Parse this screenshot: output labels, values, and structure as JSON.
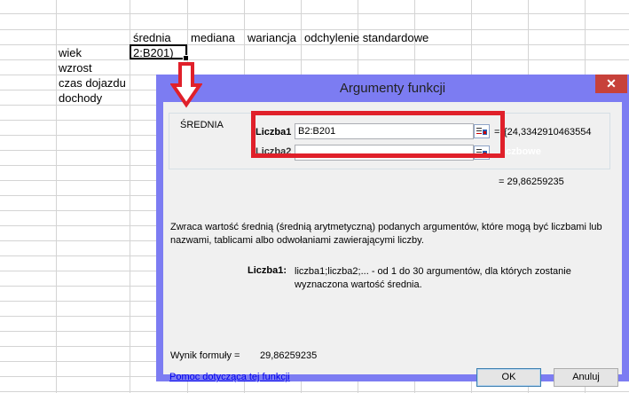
{
  "sheet": {
    "headers": [
      "średnia",
      "mediana",
      "wariancja",
      "odchylenie standardowe"
    ],
    "rows": [
      "wiek",
      "wzrost",
      "czas dojazdu",
      "dochody"
    ],
    "active_cell_value": "2:B201)"
  },
  "dialog": {
    "title": "Argumenty funkcji",
    "close_symbol": "✕",
    "function_name": "ŚREDNIA",
    "args": [
      {
        "label": "Liczba1",
        "value": "B2:B201",
        "result": "{24,3342910463554"
      },
      {
        "label": "Liczba2",
        "value": "",
        "result": "liczbowe"
      }
    ],
    "eq_symbol": "=",
    "total_result": "= 29,86259235",
    "description": "Zwraca wartość średnią (średnią arytmetyczną) podanych argumentów, które mogą być liczbami lub nazwami, tablicami albo odwołaniami zawierającymi liczby.",
    "arg_desc_label": "Liczba1:",
    "arg_desc": "liczba1;liczba2;... - od 1 do 30 argumentów, dla których zostanie wyznaczona wartość średnia.",
    "formula_result_label": "Wynik formuły =",
    "formula_result_value": "29,86259235",
    "help_link": "Pomoc dotycząca tej funkcji",
    "ok_label": "OK",
    "cancel_label": "Anuluj"
  },
  "colors": {
    "dialog_frame": "#7c7cf2",
    "highlight": "#e0202a",
    "close_button": "#c7413a"
  }
}
